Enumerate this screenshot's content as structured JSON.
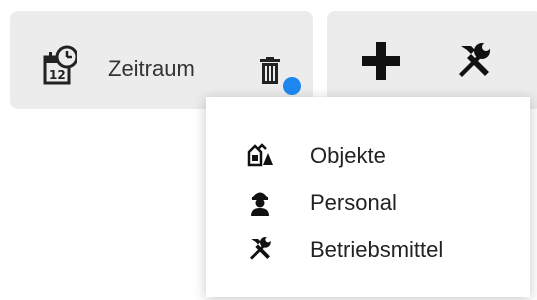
{
  "toolbar": {
    "period_label": "Zeitraum",
    "calendar_icon": "calendar-clock-icon",
    "trash_icon": "trash-icon",
    "add_icon": "plus-icon",
    "tools_icon": "tools-icon",
    "status_dot_color": "#1e88f0"
  },
  "menu": {
    "items": [
      {
        "label": "Objekte",
        "icon": "objects-icon"
      },
      {
        "label": "Personal",
        "icon": "worker-icon"
      },
      {
        "label": "Betriebsmittel",
        "icon": "tools-icon"
      }
    ]
  }
}
